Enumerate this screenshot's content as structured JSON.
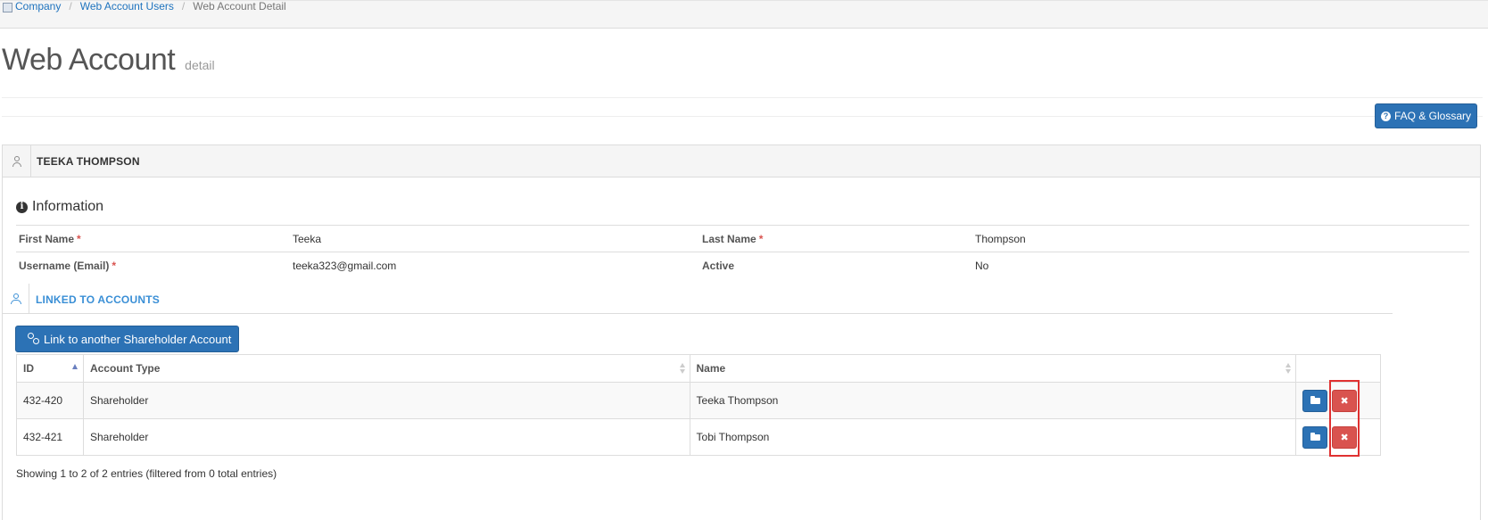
{
  "breadcrumb": {
    "items": [
      "Company",
      "Web Account Users"
    ],
    "current": "Web Account Detail"
  },
  "page": {
    "title": "Web Account",
    "subtitle": "detail"
  },
  "faq_button": {
    "label": "FAQ & Glossary",
    "icon": "question-circle-icon"
  },
  "user_panel": {
    "title": "TEEKA THOMPSON",
    "icon": "user-icon"
  },
  "information": {
    "heading": "Information",
    "icon": "info-circle-icon",
    "fields": [
      {
        "label": "First Name",
        "required": true,
        "value": "Teeka"
      },
      {
        "label": "Last Name",
        "required": true,
        "value": "Thompson"
      },
      {
        "label": "Username (Email)",
        "required": true,
        "value": "teeka323@gmail.com"
      },
      {
        "label": "Active",
        "required": false,
        "value": "No"
      }
    ],
    "required_marker": "*"
  },
  "linked": {
    "title": "LINKED TO ACCOUNTS",
    "icon": "users-icon",
    "link_button": "Link to another Shareholder Account",
    "columns": [
      "ID",
      "Account Type",
      "Name",
      ""
    ],
    "rows": [
      {
        "id": "432-420",
        "account_type": "Shareholder",
        "name": "Teeka Thompson"
      },
      {
        "id": "432-421",
        "account_type": "Shareholder",
        "name": "Tobi Thompson"
      }
    ],
    "delete_glyph": "✖",
    "table_info": "Showing 1 to 2 of 2 entries (filtered from 0 total entries)"
  },
  "colors": {
    "primary": "#2c72b5",
    "danger": "#d9534f",
    "link": "#1e73be",
    "highlight": "#e03131"
  }
}
